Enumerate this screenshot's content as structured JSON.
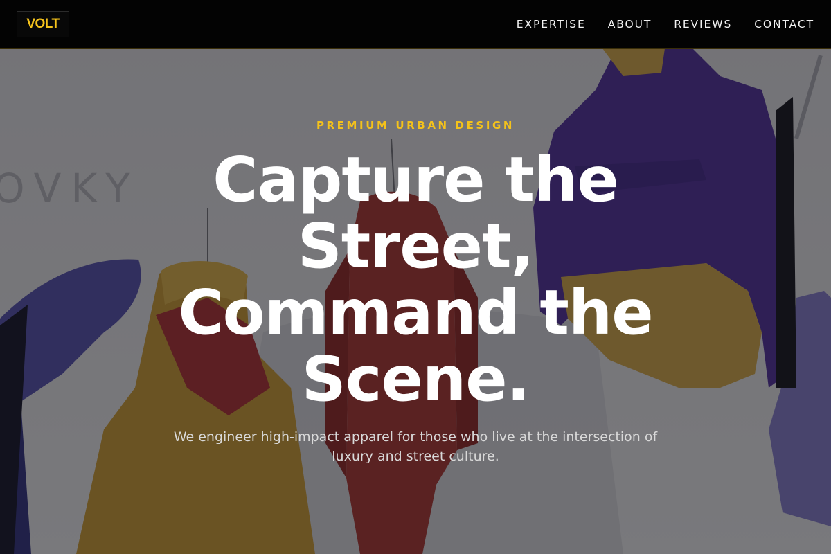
{
  "header": {
    "logo_text": "VOLT",
    "nav": [
      {
        "label": "EXPERTISE"
      },
      {
        "label": "ABOUT"
      },
      {
        "label": "REVIEWS"
      },
      {
        "label": "CONTACT"
      }
    ]
  },
  "hero": {
    "eyebrow": "PREMIUM URBAN DESIGN",
    "headline_lines": [
      "Capture the",
      "Street,",
      "Command the",
      "Scene."
    ],
    "subtitle": "We engineer high-impact apparel for those who live at the intersection of luxury and street culture.",
    "background_image": "clothing-rack-jackets-photo"
  },
  "colors": {
    "accent": "#f4c21b",
    "header_bg": "#030303",
    "text": "#ffffff"
  }
}
